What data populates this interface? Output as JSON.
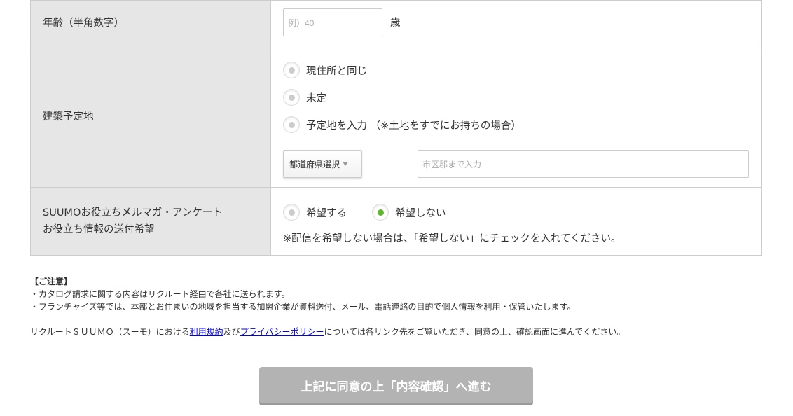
{
  "form": {
    "age": {
      "label": "年齢（半角数字）",
      "placeholder": "例）40",
      "unit": "歳"
    },
    "site": {
      "label": "建築予定地",
      "options": [
        "現住所と同じ",
        "未定",
        "予定地を入力 （※土地をすでにお持ちの場合）"
      ],
      "prefecture_select": "都道府県選択",
      "city_placeholder": "市区郡まで入力"
    },
    "mailmag": {
      "label_line1": "SUUMOお役立ちメルマガ・アンケート",
      "label_line2": "お役立ち情報の送付希望",
      "option_yes": "希望する",
      "option_no": "希望しない",
      "selected": "希望しない",
      "note": "※配信を希望しない場合は、「希望しない」にチェックを入れてください。"
    }
  },
  "notes": {
    "heading": "【ご注意】",
    "line1": "・カタログ請求に関する内容はリクルート経由で各社に送られます。",
    "line2": "・フランチャイズ等では、本部とお住まいの地域を担当する加盟企業が資料送付、メール、電話連絡の目的で個人情報を利用・保管いたします。"
  },
  "consent": {
    "prefix": "リクルートＳＵＵＭＯ（スーモ）における",
    "terms_link": "利用規約",
    "middle": "及び",
    "privacy_link": "プライバシーポリシー",
    "suffix": "については各リンク先をご覧いただき、同意の上、確認画面に進んでください。"
  },
  "submit": {
    "label": "上記に同意の上「内容確認」へ進む"
  },
  "colors": {
    "label_bg": "#e6e6e6",
    "border": "#cccccc",
    "radio_selected": "#5fb52e",
    "button_disabled": "#b3b3b3",
    "link": "#0000ee"
  }
}
